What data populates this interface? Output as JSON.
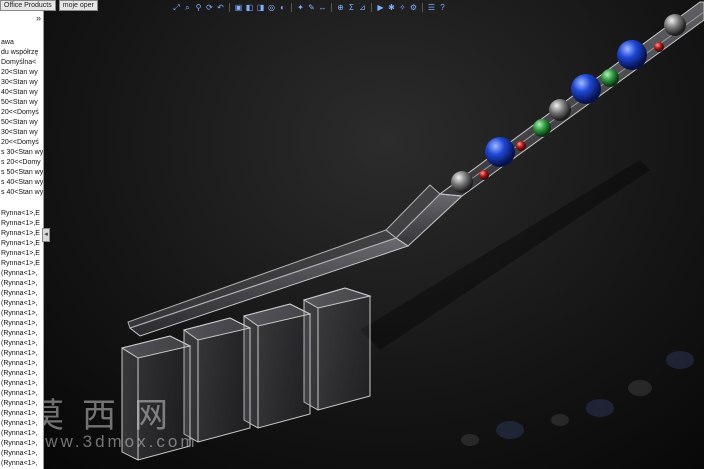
{
  "tabs": [
    "Office Products",
    "moje oper"
  ],
  "toolbar": {
    "icons": [
      "zoom-to-fit-icon",
      "zoom-area-icon",
      "zoom-in-out-icon",
      "rotate-icon",
      "undo-icon",
      "sep",
      "view-orientation-icon",
      "section-view-icon",
      "display-style-icon",
      "hide-show-icon",
      "edit-appearance-icon",
      "sep",
      "apply-scene-icon",
      "sketch-icon",
      "smart-dimension-icon",
      "sep",
      "mate-icon",
      "sum-icon",
      "measure-icon",
      "sep",
      "simulation-icon",
      "explode-icon",
      "render-icon",
      "options-icon",
      "sep",
      "settings-icon",
      "help-icon"
    ]
  },
  "tree": {
    "collapse_glyph": "»",
    "items": [
      "awa",
      "du współrzę",
      "Domyślna<",
      "20<Stan wy",
      "30<Stan wy",
      "40<Stan wy",
      "50<Stan wy",
      "20<<Domyś",
      "50<Stan wy",
      "30<Stan wy",
      "20<<Domyś",
      "s 30<Stan wy",
      "s 20<<Domy",
      "s 50<Stan wy",
      "s 40<Stan wy",
      "s 40<Stan wy",
      "",
      "Rynna<1>,E",
      "Rynna<1>,E",
      "Rynna<1>,E",
      "Rynna<1>,E",
      "Rynna<1>,E",
      "Rynna<1>,E",
      "(Rynna<1>,",
      "(Rynna<1>,",
      "(Rynna<1>,",
      "(Rynna<1>,",
      "(Rynna<1>,",
      "(Rynna<1>,",
      "(Rynna<1>,",
      "(Rynna<1>,",
      "(Rynna<1>,",
      "(Rynna<1>,",
      "(Rynna<1>,",
      "(Rynna<1>,",
      "(Rynna<1>,",
      "(Rynna<1>,",
      "(Rynna<1>,",
      "(Rynna<1>,",
      "(Rynna<1>,",
      "(Rynna<1>,",
      "(Rynna<1>,",
      "(Rynna<1>,",
      "(Rynna<1>,"
    ]
  },
  "splitter_glyph": "◂",
  "watermark": {
    "cn": "莫西网",
    "url": "www.3dmox.com"
  },
  "colors": {
    "blue_ball": "#1a3fd0",
    "red_ball": "#b21a1a",
    "green_ball": "#2e9a3e",
    "gray_ball": "#8a8a8a",
    "glass_edge": "#c8c8c8"
  }
}
